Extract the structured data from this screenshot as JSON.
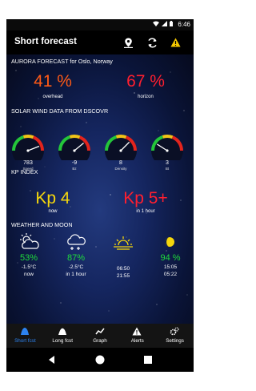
{
  "status_bar": {
    "time": "6:46",
    "icons": [
      "wifi-icon",
      "signal-icon",
      "battery-icon"
    ]
  },
  "app_bar": {
    "title": "Short forecast",
    "actions": [
      "map-pin-icon",
      "refresh-icon",
      "warning-icon"
    ]
  },
  "aurora": {
    "heading": "AURORA FORECAST for Oslo, Norway",
    "overhead": {
      "value": "41 %",
      "label": "overhead",
      "color": "#ff5a16"
    },
    "horizon": {
      "value": "67 %",
      "label": "horizon",
      "color": "#ff1f2f"
    }
  },
  "solar_wind": {
    "heading": "SOLAR WIND DATA FROM DSCOVR",
    "gauges": [
      {
        "value": "783",
        "label": "Speed",
        "level": 0.88
      },
      {
        "value": "-9",
        "label": "Bz",
        "level": 0.78
      },
      {
        "value": "8",
        "label": "Density",
        "level": 0.75
      },
      {
        "value": "3",
        "label": "Bt",
        "level": 0.18
      }
    ]
  },
  "kp_index": {
    "heading": "KP INDEX",
    "now": {
      "value": "Kp 4",
      "label": "now",
      "color": "#f5d60c"
    },
    "in_1_hour": {
      "value": "Kp 5+",
      "label": "in 1 hour",
      "color": "#ff1f2f"
    }
  },
  "weather": {
    "heading": "WEATHER AND MOON",
    "items": [
      {
        "icon": "partly-cloudy-night-icon",
        "percent": "53%",
        "line1": "-1.5°C",
        "line2": "now"
      },
      {
        "icon": "snow-cloud-icon",
        "percent": "87%",
        "line1": "-2.5°C",
        "line2": "in 1 hour"
      },
      {
        "icon": "sunrise-sunset-icon",
        "percent": "",
        "line1": "06:50",
        "line2": "21:55"
      },
      {
        "icon": "moon-phase-icon",
        "percent": "94 %",
        "line1": "15:05",
        "line2": "05:22"
      }
    ],
    "percent_color": "#1fdc3c"
  },
  "bottom_nav": {
    "items": [
      {
        "label": "Short fcst",
        "icon": "aurora-icon",
        "active": true
      },
      {
        "label": "Long fcst",
        "icon": "aurora-long-icon",
        "active": false
      },
      {
        "label": "Graph",
        "icon": "graph-icon",
        "active": false
      },
      {
        "label": "Alerts",
        "icon": "alert-icon",
        "active": false
      },
      {
        "label": "Settings",
        "icon": "settings-icon",
        "active": false
      }
    ],
    "active_color": "#2d83f0"
  },
  "system_nav": [
    "back-icon",
    "home-icon",
    "recents-icon"
  ]
}
